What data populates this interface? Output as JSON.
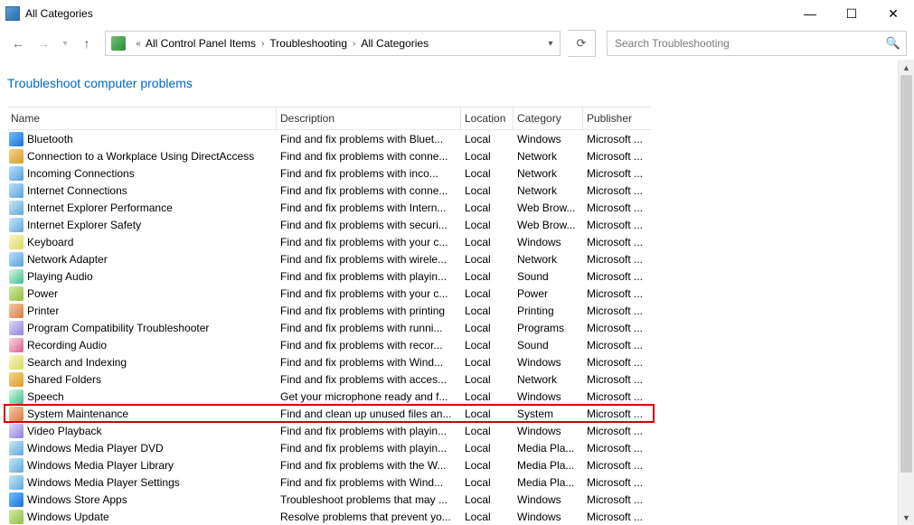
{
  "window": {
    "title": "All Categories"
  },
  "breadcrumb": [
    "All Control Panel Items",
    "Troubleshooting",
    "All Categories"
  ],
  "search": {
    "placeholder": "Search Troubleshooting"
  },
  "heading": "Troubleshoot computer problems",
  "columns": {
    "name": "Name",
    "description": "Description",
    "location": "Location",
    "category": "Category",
    "publisher": "Publisher"
  },
  "highlight_index": 16,
  "rows": [
    {
      "icon": "ic0",
      "name": "Bluetooth",
      "desc": "Find and fix problems with Bluet...",
      "loc": "Local",
      "cat": "Windows",
      "pub": "Microsoft ..."
    },
    {
      "icon": "ic1",
      "name": "Connection to a Workplace Using DirectAccess",
      "desc": "Find and fix problems with conne...",
      "loc": "Local",
      "cat": "Network",
      "pub": "Microsoft ..."
    },
    {
      "icon": "ic2",
      "name": "Incoming Connections",
      "desc": "Find and fix problems with inco...",
      "loc": "Local",
      "cat": "Network",
      "pub": "Microsoft ..."
    },
    {
      "icon": "ic2",
      "name": "Internet Connections",
      "desc": "Find and fix problems with conne...",
      "loc": "Local",
      "cat": "Network",
      "pub": "Microsoft ..."
    },
    {
      "icon": "ic9",
      "name": "Internet Explorer Performance",
      "desc": "Find and fix problems with Intern...",
      "loc": "Local",
      "cat": "Web Brow...",
      "pub": "Microsoft ..."
    },
    {
      "icon": "ic9",
      "name": "Internet Explorer Safety",
      "desc": "Find and fix problems with securi...",
      "loc": "Local",
      "cat": "Web Brow...",
      "pub": "Microsoft ..."
    },
    {
      "icon": "ic8",
      "name": "Keyboard",
      "desc": "Find and fix problems with your c...",
      "loc": "Local",
      "cat": "Windows",
      "pub": "Microsoft ..."
    },
    {
      "icon": "ic2",
      "name": "Network Adapter",
      "desc": "Find and fix problems with wirele...",
      "loc": "Local",
      "cat": "Network",
      "pub": "Microsoft ..."
    },
    {
      "icon": "ic7",
      "name": "Playing Audio",
      "desc": "Find and fix problems with playin...",
      "loc": "Local",
      "cat": "Sound",
      "pub": "Microsoft ..."
    },
    {
      "icon": "ic3",
      "name": "Power",
      "desc": "Find and fix problems with your c...",
      "loc": "Local",
      "cat": "Power",
      "pub": "Microsoft ..."
    },
    {
      "icon": "ic4",
      "name": "Printer",
      "desc": "Find and fix problems with printing",
      "loc": "Local",
      "cat": "Printing",
      "pub": "Microsoft ..."
    },
    {
      "icon": "ic5",
      "name": "Program Compatibility Troubleshooter",
      "desc": "Find and fix problems with runni...",
      "loc": "Local",
      "cat": "Programs",
      "pub": "Microsoft ..."
    },
    {
      "icon": "ic6",
      "name": "Recording Audio",
      "desc": "Find and fix problems with recor...",
      "loc": "Local",
      "cat": "Sound",
      "pub": "Microsoft ..."
    },
    {
      "icon": "ic8",
      "name": "Search and Indexing",
      "desc": "Find and fix problems with Wind...",
      "loc": "Local",
      "cat": "Windows",
      "pub": "Microsoft ..."
    },
    {
      "icon": "ic1",
      "name": "Shared Folders",
      "desc": "Find and fix problems with acces...",
      "loc": "Local",
      "cat": "Network",
      "pub": "Microsoft ..."
    },
    {
      "icon": "ic7",
      "name": "Speech",
      "desc": "Get your microphone ready and f...",
      "loc": "Local",
      "cat": "Windows",
      "pub": "Microsoft ..."
    },
    {
      "icon": "ic4",
      "name": "System Maintenance",
      "desc": "Find and clean up unused files an...",
      "loc": "Local",
      "cat": "System",
      "pub": "Microsoft ..."
    },
    {
      "icon": "ic5",
      "name": "Video Playback",
      "desc": "Find and fix problems with playin...",
      "loc": "Local",
      "cat": "Windows",
      "pub": "Microsoft ..."
    },
    {
      "icon": "ic9",
      "name": "Windows Media Player DVD",
      "desc": "Find and fix problems with playin...",
      "loc": "Local",
      "cat": "Media Pla...",
      "pub": "Microsoft ..."
    },
    {
      "icon": "ic9",
      "name": "Windows Media Player Library",
      "desc": "Find and fix problems with the W...",
      "loc": "Local",
      "cat": "Media Pla...",
      "pub": "Microsoft ..."
    },
    {
      "icon": "ic9",
      "name": "Windows Media Player Settings",
      "desc": "Find and fix problems with Wind...",
      "loc": "Local",
      "cat": "Media Pla...",
      "pub": "Microsoft ..."
    },
    {
      "icon": "ic0",
      "name": "Windows Store Apps",
      "desc": "Troubleshoot problems that may ...",
      "loc": "Local",
      "cat": "Windows",
      "pub": "Microsoft ..."
    },
    {
      "icon": "ic3",
      "name": "Windows Update",
      "desc": "Resolve problems that prevent yo...",
      "loc": "Local",
      "cat": "Windows",
      "pub": "Microsoft ..."
    }
  ]
}
